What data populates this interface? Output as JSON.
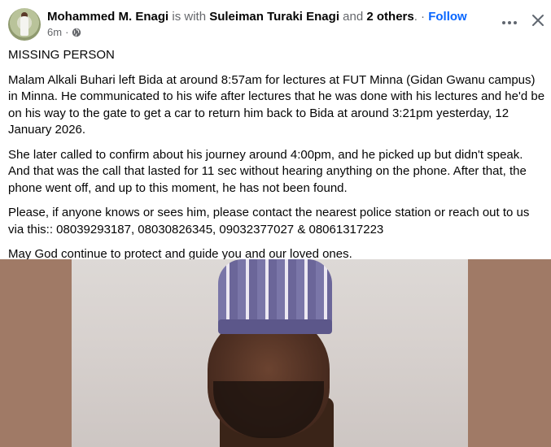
{
  "post": {
    "author": "Mohammed M. Enagi",
    "with_text": "is with",
    "tagged": "Suleiman Turaki Enagi",
    "and_text": "and",
    "others": "2 others",
    "dot": ". ·",
    "follow": "Follow",
    "time": "6m",
    "meta_dot": "·",
    "privacy_icon": "globe-icon",
    "paragraphs": [
      "MISSING PERSON",
      "Malam Alkali Buhari left Bida at around 8:57am for lectures at FUT Minna (Gidan Gwanu campus) in Minna. He communicated to his wife after lectures that he was done with his lectures and he'd be on his way to the gate to get a car to return him back to Bida at around 3:21pm yesterday, 12 January 2026.",
      "She later called to confirm about his journey around 4:00pm, and he picked up but didn't speak. And that was the call that lasted for 11 sec without hearing anything on the phone. After that, the phone went off, and up to this moment, he has not been found.",
      "Please, if anyone knows or sees him, please contact the nearest police station or reach out to us via this:: 08039293187, 08030826345, 09032377027 & 08061317223",
      "May God continue to protect and guide you and our loved ones."
    ]
  },
  "colors": {
    "link": "#0866ff",
    "muted": "#65676b",
    "text": "#050505"
  }
}
